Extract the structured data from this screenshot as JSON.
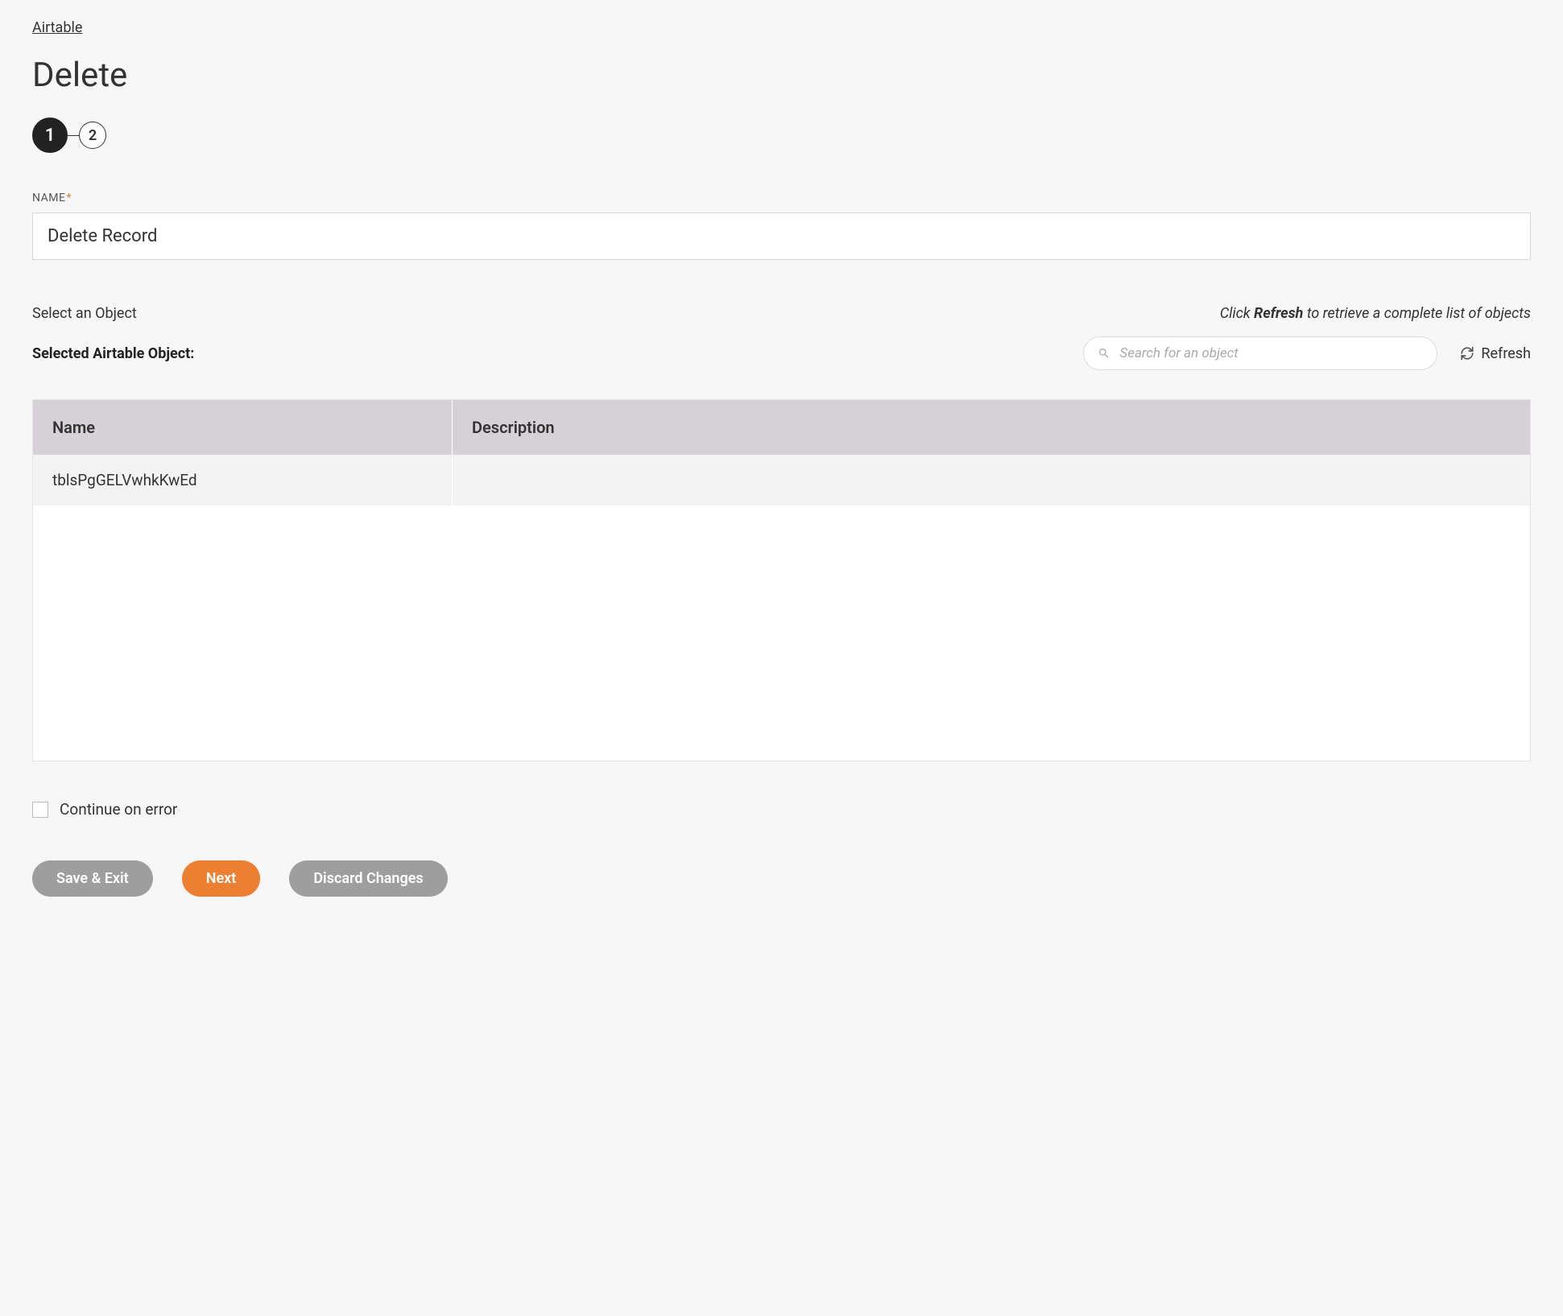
{
  "breadcrumb": "Airtable",
  "page_title": "Delete",
  "stepper": {
    "step1": "1",
    "step2": "2"
  },
  "name_field": {
    "label": "NAME",
    "required_mark": "*",
    "value": "Delete Record"
  },
  "object_section": {
    "select_label": "Select an Object",
    "refresh_hint_pre": "Click ",
    "refresh_hint_strong": "Refresh",
    "refresh_hint_post": " to retrieve a complete list of objects",
    "selected_label": "Selected Airtable Object:",
    "search_placeholder": "Search for an object",
    "refresh_label": "Refresh"
  },
  "table": {
    "headers": {
      "name": "Name",
      "description": "Description"
    },
    "rows": [
      {
        "name": "tblsPgGELVwhkKwEd",
        "description": ""
      }
    ]
  },
  "continue_on_error_label": "Continue on error",
  "buttons": {
    "save_exit": "Save & Exit",
    "next": "Next",
    "discard": "Discard Changes"
  }
}
